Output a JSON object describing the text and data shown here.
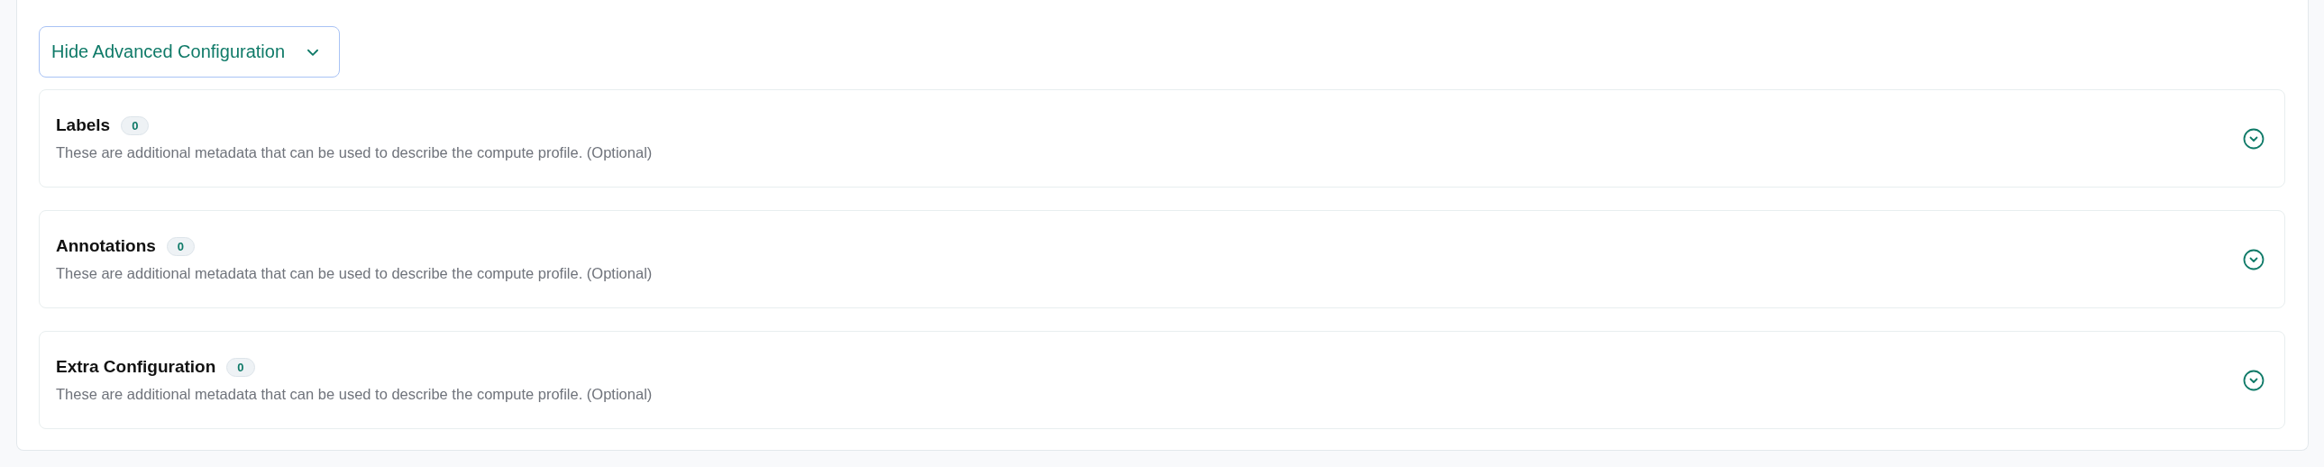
{
  "toggle_button": {
    "label": "Hide Advanced Configuration"
  },
  "sections": [
    {
      "title": "Labels",
      "count": "0",
      "description": "These are additional metadata that can be used to describe the compute profile. (Optional)",
      "expanded": false
    },
    {
      "title": "Annotations",
      "count": "0",
      "description": "These are additional metadata that can be used to describe the compute profile. (Optional)",
      "expanded": false
    },
    {
      "title": "Extra Configuration",
      "count": "0",
      "description": "These are additional metadata that can be used to describe the compute profile. (Optional)",
      "expanded": false
    }
  ]
}
